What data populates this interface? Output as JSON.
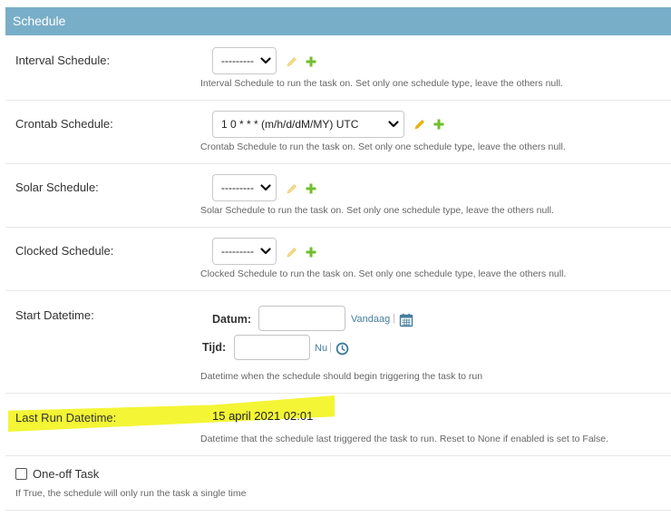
{
  "fieldset": {
    "title": "Schedule"
  },
  "interval": {
    "label": "Interval Schedule:",
    "value": "---------",
    "help": "Interval Schedule to run the task on.  Set only one schedule type, leave the others null."
  },
  "crontab": {
    "label": "Crontab Schedule:",
    "value": "1 0 * * * (m/h/d/dM/MY) UTC",
    "help": "Crontab Schedule to run the task on.  Set only one schedule type, leave the others null."
  },
  "solar": {
    "label": "Solar Schedule:",
    "value": "---------",
    "help": "Solar Schedule to run the task on.  Set only one schedule type, leave the others null."
  },
  "clocked": {
    "label": "Clocked Schedule:",
    "value": "---------",
    "help": "Clocked Schedule to run the task on.  Set only one schedule type, leave the others null."
  },
  "start_datetime": {
    "label": "Start Datetime:",
    "date_label": "Datum:",
    "date_value": "",
    "today_link": "Vandaag",
    "time_label": "Tijd:",
    "time_value": "",
    "now_link": "Nu",
    "separator": "|",
    "help": "Datetime when the schedule should begin triggering the task to run"
  },
  "last_run": {
    "label": "Last Run Datetime:",
    "value": "15 april 2021 02:01",
    "help": "Datetime that the schedule last triggered the task to run. Reset to None if enabled is set to False."
  },
  "one_off": {
    "label": "One-off Task",
    "checked": false,
    "help": "If True, the schedule will only run the task a single time"
  },
  "colors": {
    "header_bg": "#79aec8",
    "link": "#447e9b",
    "add_icon": "#70bf2b",
    "change_icon": "#efb80b",
    "highlight": "#f3f535"
  },
  "icons": {
    "select_arrow": "chevron-down-icon",
    "change": "pencil-icon",
    "add": "plus-icon",
    "calendar": "calendar-icon",
    "clock": "clock-icon"
  }
}
